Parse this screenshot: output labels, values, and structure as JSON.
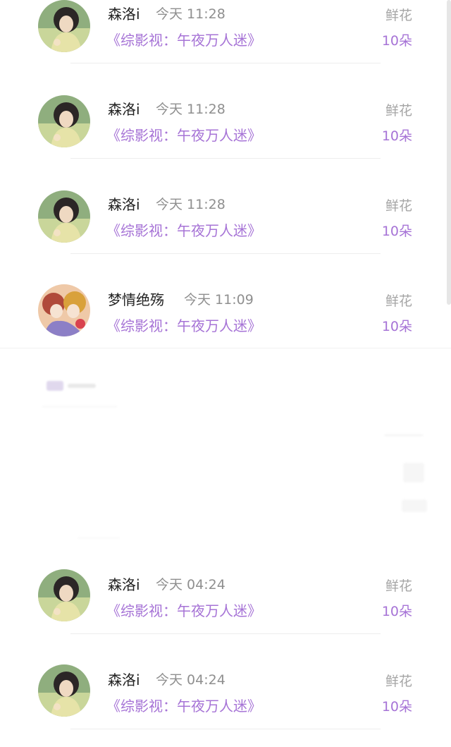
{
  "records": [
    {
      "name": "森洛i",
      "time": "今天 11:28",
      "book": "《综影视：午夜万人迷》",
      "gift": "鲜花",
      "count": "10朵",
      "avatar_icon": "girl-portrait-icon"
    },
    {
      "name": "森洛i",
      "time": "今天 11:28",
      "book": "《综影视：午夜万人迷》",
      "gift": "鲜花",
      "count": "10朵",
      "avatar_icon": "girl-portrait-icon"
    },
    {
      "name": "森洛i",
      "time": "今天 11:28",
      "book": "《综影视：午夜万人迷》",
      "gift": "鲜花",
      "count": "10朵",
      "avatar_icon": "girl-portrait-icon"
    },
    {
      "name": "梦情绝殇",
      "time": "今天 11:09",
      "book": "《综影视：午夜万人迷》",
      "gift": "鲜花",
      "count": "10朵",
      "avatar_icon": "cartoon-girls-icon"
    },
    {
      "name": "森洛i",
      "time": "今天 04:24",
      "book": "《综影视：午夜万人迷》",
      "gift": "鲜花",
      "count": "10朵",
      "avatar_icon": "girl-portrait-icon"
    },
    {
      "name": "森洛i",
      "time": "今天 04:24",
      "book": "《综影视：午夜万人迷》",
      "gift": "鲜花",
      "count": "10朵",
      "avatar_icon": "girl-portrait-icon"
    }
  ],
  "colors": {
    "accent": "#a673d6",
    "name_text": "#222222",
    "muted_text": "#8f8f8f"
  }
}
